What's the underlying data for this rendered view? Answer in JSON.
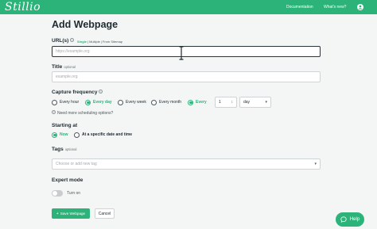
{
  "header": {
    "logo": "Stillio",
    "nav": [
      "Documentation",
      "What's new?"
    ]
  },
  "page": {
    "title": "Add Webpage"
  },
  "url_field": {
    "label": "URL(s)",
    "modes": [
      "Single",
      "Multiple",
      "From Sitemap"
    ],
    "active_mode": "Single",
    "placeholder": "https://example.org"
  },
  "title_field": {
    "label": "Title",
    "optional": "optional",
    "placeholder": "example.org"
  },
  "capture": {
    "label": "Capture frequency",
    "options": [
      "Every hour",
      "Every day",
      "Every week",
      "Every month",
      "Every"
    ],
    "selected": [
      "Every day",
      "Every"
    ],
    "every_value": "1",
    "every_unit": "day",
    "help": "Need more scheduling options?"
  },
  "starting": {
    "label": "Starting at",
    "options": [
      "Now",
      "At a specific date and time"
    ],
    "selected": "Now"
  },
  "tags": {
    "label": "Tags",
    "optional": "optional",
    "placeholder": "Choose or add new tag"
  },
  "expert": {
    "label": "Expert mode",
    "toggle_label": "Turn on",
    "on": false
  },
  "actions": {
    "save": "Save Webpage",
    "cancel": "Cancel"
  },
  "help_button": "Help",
  "colors": {
    "brand": "#2cb37a",
    "text": "#1f2a30",
    "background": "#f4f5f5"
  }
}
